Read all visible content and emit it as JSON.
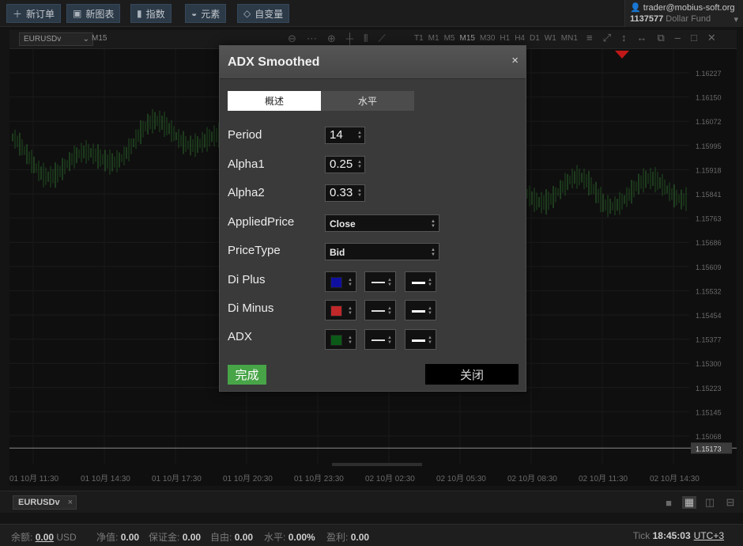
{
  "toolbar": {
    "new_order": "新订单",
    "new_chart": "新图表",
    "indicators": "指数",
    "elements": "元素",
    "custom_vars": "自变量"
  },
  "account": {
    "user": "trader@mobius-soft.org",
    "number": "1137577",
    "fund": "Dollar Fund"
  },
  "chart_toolbar": {
    "symbol": "EURUSDv",
    "timeframe": "M15",
    "timeframes": [
      "T1",
      "M1",
      "M5",
      "M15",
      "M30",
      "H1",
      "H4",
      "D1",
      "W1",
      "MN1"
    ]
  },
  "chart": {
    "current_price": "1.15173",
    "price_levels": [
      "1.16227",
      "1.16150",
      "1.16072",
      "1.15995",
      "1.15918",
      "1.15841",
      "1.15763",
      "1.15686",
      "1.15609",
      "1.15532",
      "1.15454",
      "1.15377",
      "1.15300",
      "1.15223",
      "1.15145",
      "1.15068"
    ],
    "time_labels": [
      "01 10月 11:30",
      "01 10月 14:30",
      "01 10月 17:30",
      "01 10月 20:30",
      "01 10月 23:30",
      "02 10月 02:30",
      "02 10月 05:30",
      "02 10月 08:30",
      "02 10月 11:30",
      "02 10月 14:30"
    ]
  },
  "dialog": {
    "title": "ADX Smoothed",
    "close_glyph": "×",
    "tabs": [
      "概述",
      "水平"
    ],
    "fields": {
      "period": {
        "label": "Period",
        "value": "14"
      },
      "alpha1": {
        "label": "Alpha1",
        "value": "0.25"
      },
      "alpha2": {
        "label": "Alpha2",
        "value": "0.33"
      },
      "applied_price": {
        "label": "AppliedPrice",
        "value": "Close"
      },
      "price_type": {
        "label": "PriceType",
        "value": "Bid"
      },
      "di_plus": {
        "label": "Di Plus",
        "color": "#1010a0"
      },
      "di_minus": {
        "label": "Di Minus",
        "color": "#c0282a"
      },
      "adx": {
        "label": "ADX",
        "color": "#0c5a18"
      }
    },
    "done_label": "完成",
    "close_label": "关闭"
  },
  "bottom_tab": {
    "symbol": "EURUSDv",
    "close_glyph": "×"
  },
  "status": {
    "balance_label": "余额:",
    "balance_value": "0.00",
    "currency": "USD",
    "equity_label": "净值:",
    "equity_value": "0.00",
    "margin_label": "保证金:",
    "margin_value": "0.00",
    "free_label": "自由:",
    "free_value": "0.00",
    "level_label": "水平:",
    "level_value": "0.00%",
    "profit_label": "盈利:",
    "profit_value": "0.00",
    "tick_label": "Tick",
    "time": "18:45:03",
    "timezone": "UTC+3"
  }
}
